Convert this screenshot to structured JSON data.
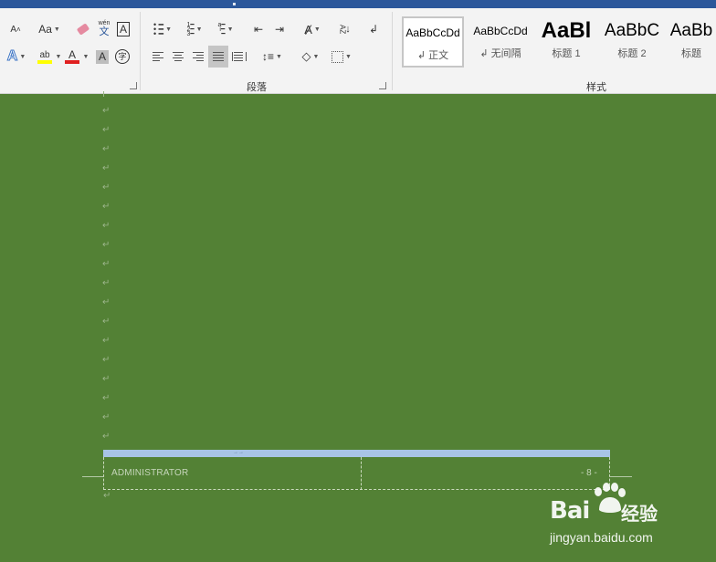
{
  "ribbon": {
    "font_group": {
      "grow_font_glyph": "A",
      "change_case_label": "Aa",
      "phonetic_guide_label": "wén",
      "phonetic_guide_char": "文",
      "char_border_label": "A",
      "text_effects_label": "A",
      "highlight_label": "ab",
      "font_color_label": "A",
      "char_shading_label": "A",
      "enclose_char_label": "字",
      "highlight_color": "#ffff00",
      "font_color": "#e02020"
    },
    "paragraph_group": {
      "label": "段落",
      "sort_label": "AZ"
    },
    "styles_group": {
      "label": "样式",
      "styles": [
        {
          "sample": "AaBbCcDd",
          "name": "↲ 正文"
        },
        {
          "sample": "AaBbCcDd",
          "name": "↲ 无间隔"
        },
        {
          "sample": "AaBl",
          "name": "标题 1"
        },
        {
          "sample": "AaBbC",
          "name": "标题 2"
        },
        {
          "sample": "AaBb",
          "name": "标题"
        }
      ]
    }
  },
  "document": {
    "paragraph_mark": "↵",
    "footer": {
      "left_text": "ADMINISTRATOR",
      "right_text": "- 8 -",
      "tab_marks": "→→"
    }
  },
  "watermark": {
    "logo": "Bai",
    "cn": "经验",
    "url": "jingyan.baidu.com"
  }
}
